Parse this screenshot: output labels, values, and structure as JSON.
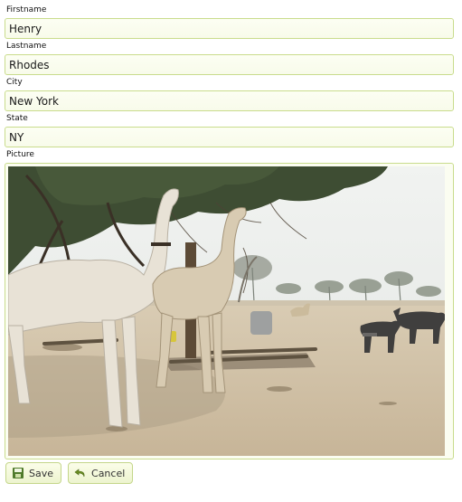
{
  "form": {
    "firstname": {
      "label": "Firstname",
      "value": "Henry"
    },
    "lastname": {
      "label": "Lastname",
      "value": "Rhodes"
    },
    "city": {
      "label": "City",
      "value": "New York"
    },
    "state": {
      "label": "State",
      "value": "NY"
    },
    "picture": {
      "label": "Picture",
      "subject": "camels-and-donkeys-photo"
    }
  },
  "buttons": {
    "save": {
      "label": "Save",
      "icon": "floppy-disk-icon"
    },
    "cancel": {
      "label": "Cancel",
      "icon": "undo-arrow-icon"
    }
  },
  "colors": {
    "field_border": "#c9dc8c",
    "field_background": "#fcfef3",
    "button_background": "#edf4cf"
  }
}
